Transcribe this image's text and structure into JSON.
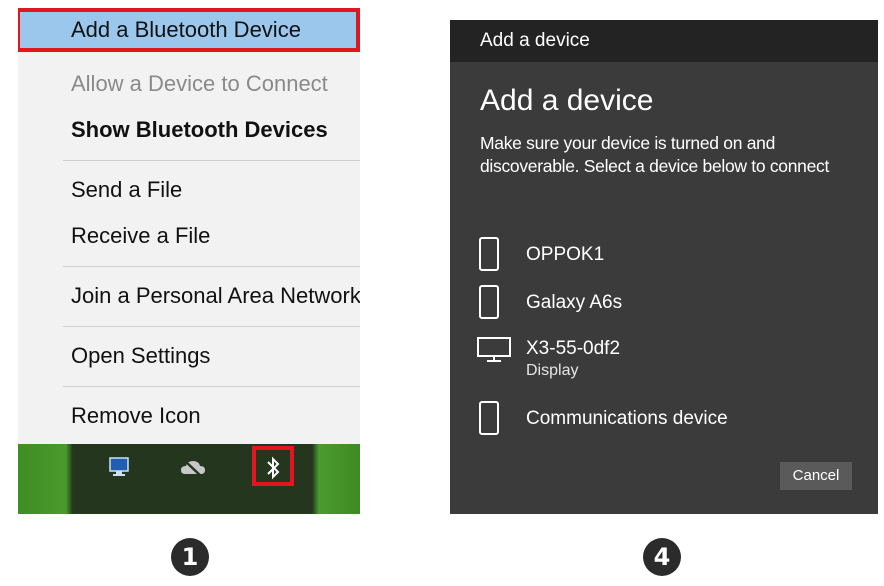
{
  "context_menu": {
    "items": [
      {
        "label": "Add a Bluetooth Device",
        "state": "highlighted"
      },
      {
        "label": "Allow a Device to Connect",
        "state": "disabled"
      },
      {
        "label": "Show Bluetooth Devices",
        "state": "bold"
      },
      {
        "label": "Send a File",
        "state": "normal"
      },
      {
        "label": "Receive a File",
        "state": "normal"
      },
      {
        "label": "Join a Personal Area Network",
        "state": "normal"
      },
      {
        "label": "Open Settings",
        "state": "normal"
      },
      {
        "label": "Remove Icon",
        "state": "normal"
      }
    ]
  },
  "taskbar": {
    "icons": [
      "network-monitor-icon",
      "onedrive-cloud-icon",
      "bluetooth-icon"
    ]
  },
  "dialog": {
    "window_title": "Add a device",
    "heading": "Add a device",
    "description": "Make sure your device is turned on and discoverable. Select a device below to connect",
    "devices": [
      {
        "name": "OPPOK1",
        "sub": "",
        "icon": "phone-icon"
      },
      {
        "name": "Galaxy A6s",
        "sub": "",
        "icon": "phone-icon"
      },
      {
        "name": "X3-55-0df2",
        "sub": "Display",
        "icon": "monitor-icon"
      },
      {
        "name": "Communications device",
        "sub": "",
        "icon": "phone-icon"
      }
    ],
    "cancel_label": "Cancel"
  },
  "steps": {
    "left": "1",
    "right": "4"
  },
  "colors": {
    "highlight_bg": "#9cc7ec",
    "callout_red": "#e0171f",
    "dialog_bg": "#3b3b3b",
    "titlebar_bg": "#232323"
  }
}
